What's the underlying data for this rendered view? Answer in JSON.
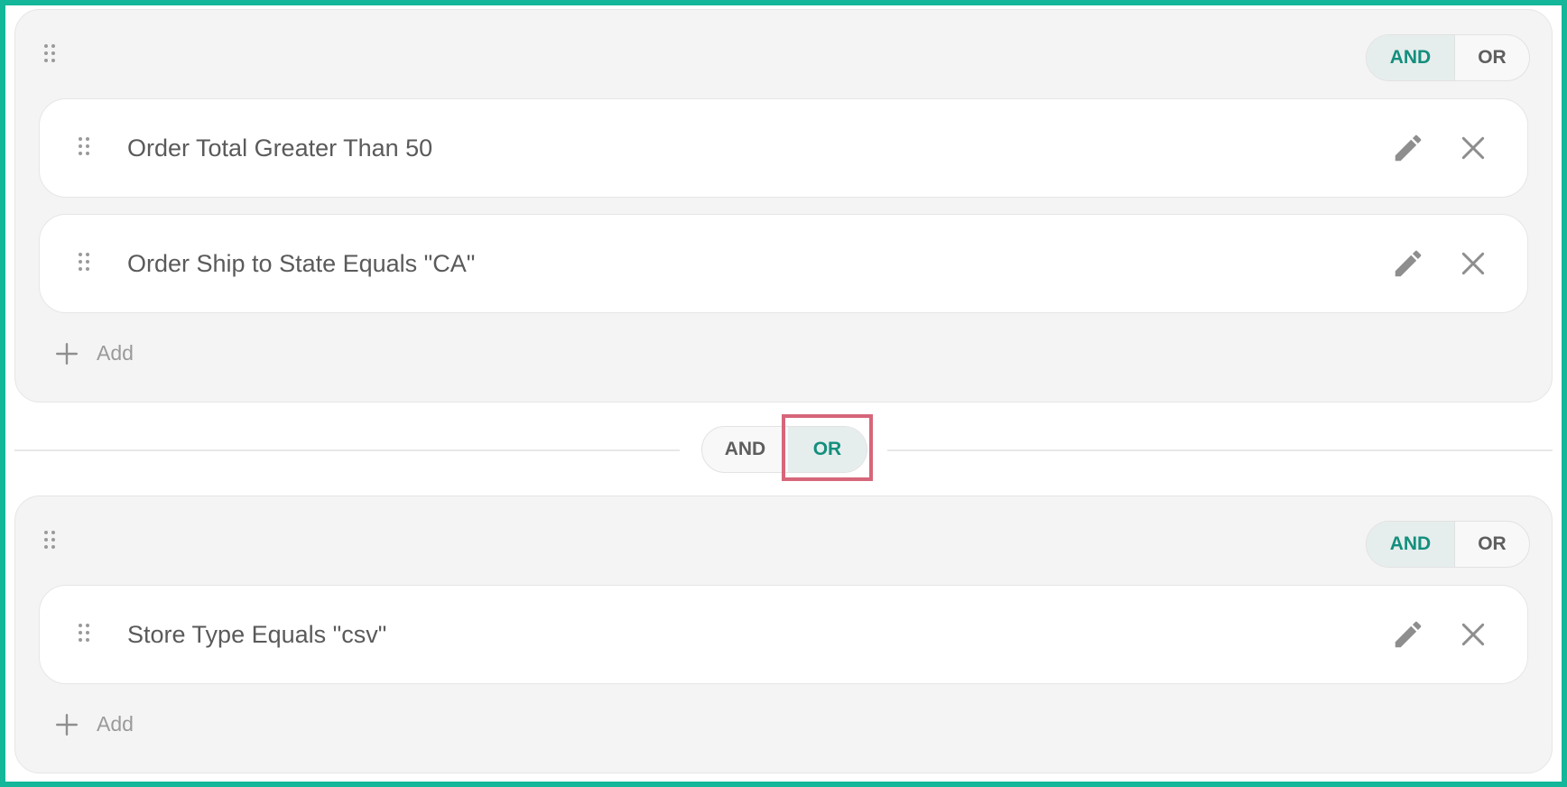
{
  "groups": [
    {
      "operators": {
        "and": "AND",
        "or": "OR",
        "selected": "AND"
      },
      "rules": [
        {
          "label": "Order Total Greater Than 50"
        },
        {
          "label": "Order Ship to State Equals \"CA\""
        }
      ],
      "add_label": "Add"
    },
    {
      "operators": {
        "and": "AND",
        "or": "OR",
        "selected": "AND"
      },
      "rules": [
        {
          "label": "Store Type Equals \"csv\""
        }
      ],
      "add_label": "Add"
    }
  ],
  "group_join": {
    "and": "AND",
    "or": "OR",
    "selected": "OR"
  },
  "icons": {
    "drag": "drag-handle-icon",
    "edit": "pencil-icon",
    "remove": "close-icon",
    "add": "plus-icon"
  },
  "colors": {
    "frame": "#14b79a",
    "active_text": "#138f7d",
    "active_bg": "#e6eded",
    "highlight": "#d6667a"
  }
}
